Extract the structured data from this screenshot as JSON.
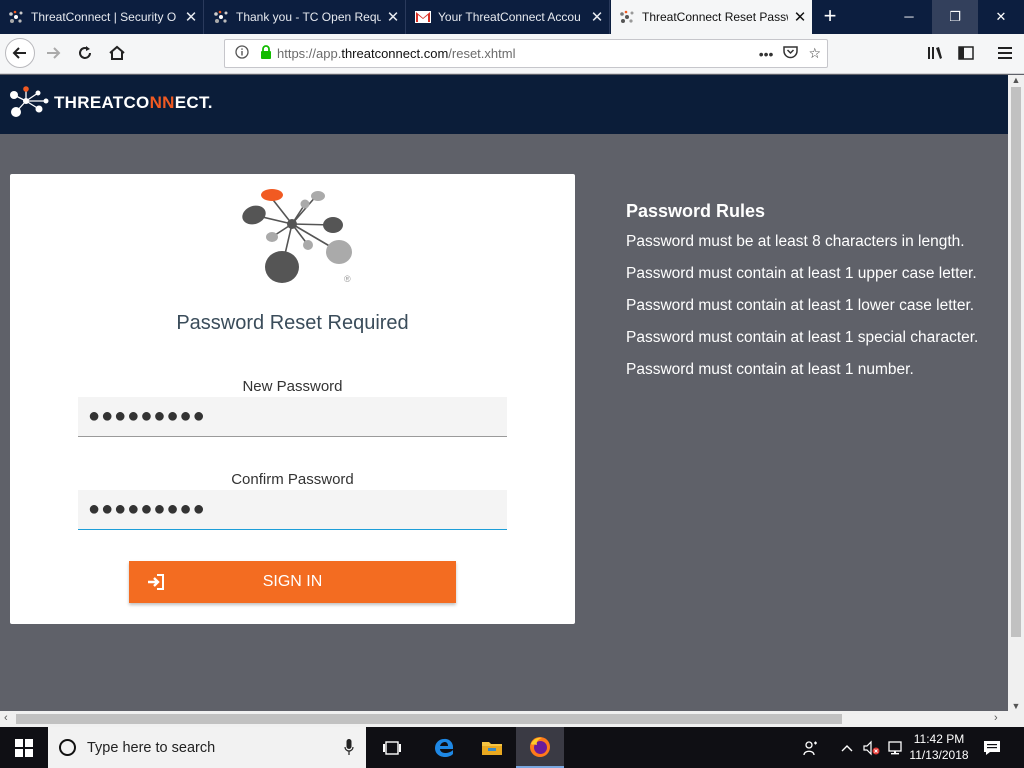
{
  "browser": {
    "tabs": [
      {
        "title": "ThreatConnect | Security O",
        "favicon": "threatconnect-favicon",
        "active": false
      },
      {
        "title": "Thank you - TC Open Requ",
        "favicon": "threatconnect-favicon",
        "active": false
      },
      {
        "title": "Your ThreatConnect Accou",
        "favicon": "gmail-favicon",
        "active": false
      },
      {
        "title": "ThreatConnect Reset Passw",
        "favicon": "threatconnect-favicon",
        "active": true
      }
    ],
    "url_prefix": "https://app.",
    "url_host": "threatconnect.com",
    "url_path": "/reset.xhtml"
  },
  "brand": {
    "name_part1": "THREATCO",
    "name_accent": "NN",
    "name_part2": "ECT."
  },
  "card": {
    "title": "Password Reset Required",
    "new_password_label": "New Password",
    "new_password_value": "●●●●●●●●●",
    "confirm_password_label": "Confirm Password",
    "confirm_password_value": "●●●●●●●●●",
    "signin_label": "SIGN IN"
  },
  "rules": {
    "title": "Password Rules",
    "items": [
      "Password must be at least 8 characters in length.",
      "Password must contain at least 1 upper case letter.",
      "Password must contain at least 1 lower case letter.",
      "Password must contain at least 1 special character.",
      "Password must contain at least 1 number."
    ]
  },
  "taskbar": {
    "search_placeholder": "Type here to search",
    "time": "11:42 PM",
    "date": "11/13/2018"
  },
  "colors": {
    "brand_navy": "#0b1d39",
    "accent_orange": "#f36c21",
    "page_bg": "#5f6169"
  }
}
